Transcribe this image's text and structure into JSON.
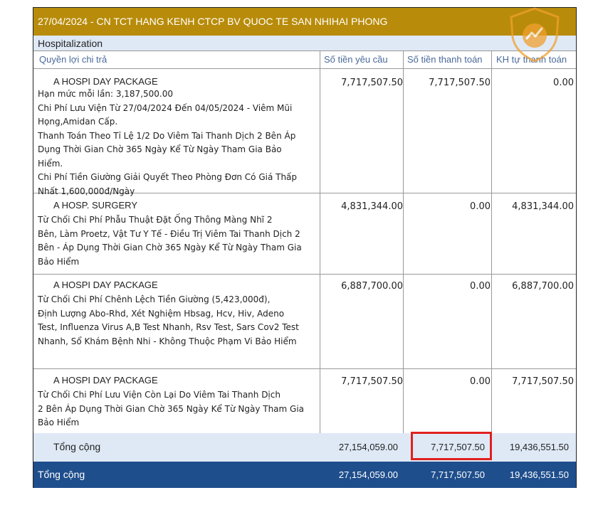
{
  "header": {
    "title": "27/04/2024 - CN TCT HANG KENH CTCP BV QUOC TE SAN NHIHAI PHONG",
    "section": "Hospitalization"
  },
  "columns": {
    "benefit": "Quyền lợi chi trả",
    "requested": "Số tiền yêu cầu",
    "paid": "Số tiền thanh toán",
    "self_paid": "KH tự thanh toán"
  },
  "rows": [
    {
      "name": "A HOSPI DAY PACKAGE",
      "description": "    Hạn mức mỗi lần: 3,187,500.00\n    Chi Phí Lưu Viện Từ 27/04/2024 Đến 04/05/2024 - Viêm Mũi\nHọng,Amidan Cấp.\nThanh Toán Theo Tỉ Lệ 1/2 Do Viêm Tai Thanh Dịch 2 Bên Áp\nDụng Thời Gian Chờ 365 Ngày Kể Từ Ngày Tham Gia Bảo\nHiểm.\nChi Phí Tiền Giường Giải Quyết Theo Phòng Đơn Có Giá Thấp\nNhất 1,600,000đ/Ngày",
      "requested": "7,717,507.50",
      "paid": "7,717,507.50",
      "self_paid": "0.00"
    },
    {
      "name": "A HOSP. SURGERY",
      "description": "    Từ Chối Chi Phí Phẫu Thuật Đặt Ống Thông Màng Nhĩ 2\nBên, Làm Proetz, Vật Tư Y Tế - Điều Trị Viêm Tai Thanh Dịch 2\nBên - Áp Dụng Thời Gian Chờ 365 Ngày Kể Từ Ngày Tham Gia\nBảo Hiểm",
      "requested": "4,831,344.00",
      "paid": "0.00",
      "self_paid": "4,831,344.00"
    },
    {
      "name": "A HOSPI DAY PACKAGE",
      "description": "    Từ Chối Chi Phí Chênh Lệch Tiền Giường (5,423,000đ),\nĐịnh Lượng Abo-Rhd, Xét Nghiệm Hbsag, Hcv, Hiv, Adeno\nTest, Influenza Virus A,B Test Nhanh, Rsv Test, Sars Cov2 Test\nNhanh, Sổ Khám Bệnh Nhi - Không Thuộc Phạm Vi Bảo Hiểm",
      "requested": "6,887,700.00",
      "paid": "0.00",
      "self_paid": "6,887,700.00"
    },
    {
      "name": "A HOSPI DAY PACKAGE",
      "description": "    Từ Chối Chi Phí Lưu Viện Còn Lại Do Viêm Tai Thanh Dịch\n2 Bên Áp Dụng Thời Gian Chờ 365 Ngày Kể Từ Ngày Tham Gia\nBảo Hiểm",
      "requested": "7,717,507.50",
      "paid": "0.00",
      "self_paid": "7,717,507.50"
    }
  ],
  "subtotal": {
    "label": "Tổng cộng",
    "requested": "27,154,059.00",
    "paid": "7,717,507.50",
    "self_paid": "19,436,551.50"
  },
  "grand_total": {
    "label": "Tổng cộng",
    "requested": "27,154,059.00",
    "paid": "7,717,507.50",
    "self_paid": "19,436,551.50"
  },
  "colors": {
    "title_bar": "#b88c0a",
    "section_bg": "#dfe9f6",
    "grand_total_bg": "#1f4e8c",
    "highlight_border": "#e0201e",
    "logo": "#f0a030"
  },
  "icons": {
    "watermark": "shield-logo-icon"
  }
}
